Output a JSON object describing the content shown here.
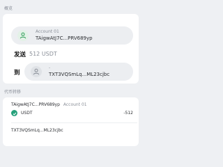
{
  "overview": {
    "title": "概览",
    "from_account": {
      "name": "Account 01",
      "address": "TAigwAtJ7C...PRV689yp"
    },
    "send_label": "发送",
    "amount": "512 USDT",
    "to_label": "到",
    "to_account": {
      "name": "-",
      "address": "TXT3VQSmLq...ML23cjbc"
    }
  },
  "token_transfer": {
    "title": "代币转移",
    "transfers": [
      {
        "address": "TAigwAtJ7C...PRV689yp",
        "account": "Account 01",
        "token": "USDT",
        "amount": "-512"
      },
      {
        "address": "TXT3VQSmLq...ML23cjbc"
      }
    ]
  },
  "colors": {
    "page_bg": "#eef0f3",
    "card_bg": "#ffffff",
    "pill_bg": "#eceef1",
    "avatar_active": "#2e9e57",
    "usdt_green": "#26a17b",
    "muted_text": "#8a8f98"
  },
  "icons": {
    "from_avatar": "user-icon",
    "to_avatar": "user-icon",
    "token": "usdt-token-icon"
  }
}
